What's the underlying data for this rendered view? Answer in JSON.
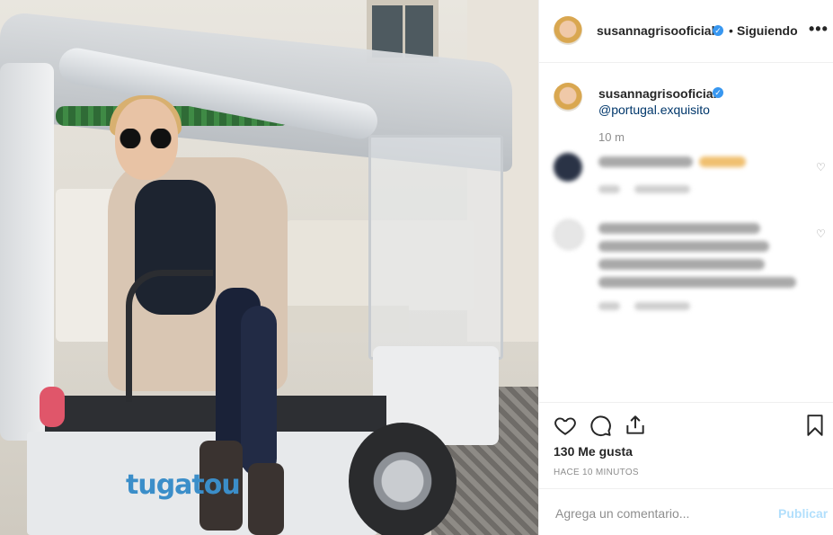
{
  "post": {
    "author": {
      "username": "susannagrisooficial",
      "verified": true,
      "follow_status": "Siguiendo",
      "separator": "•"
    },
    "more_icon": "more-options-icon",
    "caption": {
      "username": "susannagrisooficial",
      "mention": "@portugal.exquisito",
      "time": "10 m"
    },
    "comments_blurred": true,
    "actions": {
      "like_icon": "heart-icon",
      "comment_icon": "comment-icon",
      "share_icon": "share-icon",
      "save_icon": "bookmark-icon"
    },
    "likes_label": "130 Me gusta",
    "timestamp": "HACE 10 MINUTOS",
    "comment_placeholder": "Agrega un comentario...",
    "publish_label": "Publicar",
    "photo_text": "tugatou",
    "colors": {
      "verified": "#3897f0",
      "link": "#00376b",
      "publish_disabled": "#b2dffc",
      "muted": "#8e8e8e"
    }
  }
}
